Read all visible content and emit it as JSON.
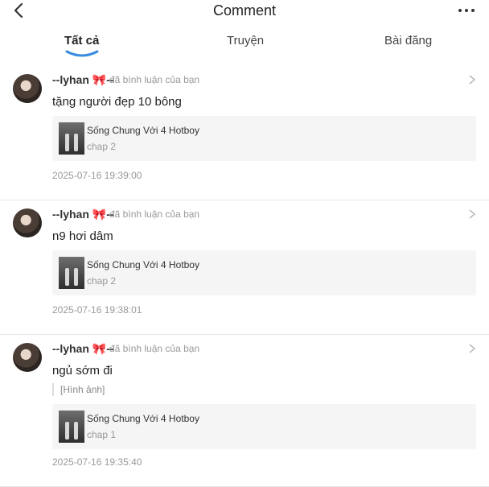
{
  "header": {
    "title": "Comment",
    "back_icon": "chevron-left-icon",
    "more_icon": "more-horizontal-icon"
  },
  "tabs": [
    {
      "label": "Tất cả",
      "active": true
    },
    {
      "label": "Truyện",
      "active": false
    },
    {
      "label": "Bài đăng",
      "active": false
    }
  ],
  "accent_color": "#3b8de0",
  "comments": [
    {
      "username": "--lyhan 🎀--",
      "action": "đã bình luận của bạn",
      "text": "tặng người đẹp 10 bông",
      "attachment": "",
      "story_title": "Sống Chung Với 4 Hotboy",
      "chapter": "chap 2",
      "time": "2025-07-16 19:39:00"
    },
    {
      "username": "--lyhan 🎀--",
      "action": "đã bình luận của bạn",
      "text": "n9 hơi dâm",
      "attachment": "",
      "story_title": "Sống Chung Với 4 Hotboy",
      "chapter": "chap 2",
      "time": "2025-07-16 19:38:01"
    },
    {
      "username": "--lyhan 🎀--",
      "action": "đã bình luận của bạn",
      "text": "ngủ sớm đi",
      "attachment": "[Hình ảnh]",
      "story_title": "Sống Chung Với 4 Hotboy",
      "chapter": "chap 1",
      "time": "2025-07-16 19:35:40"
    }
  ]
}
